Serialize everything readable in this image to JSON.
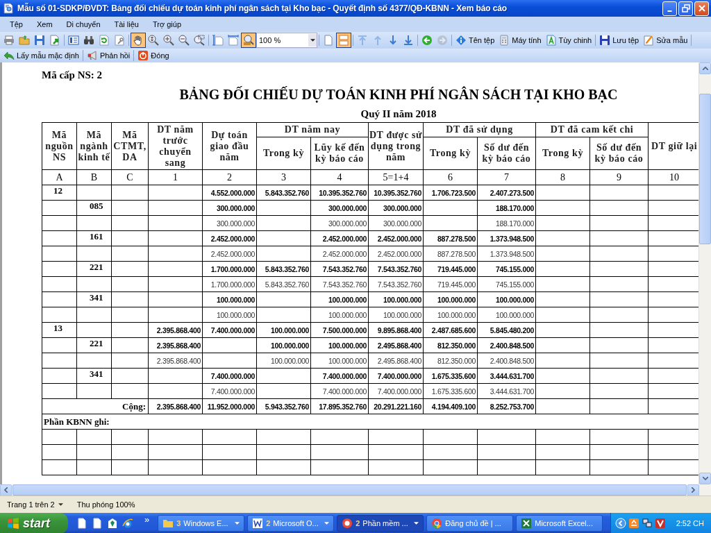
{
  "window": {
    "title": "Mẫu số 01-SDKP/ĐVDT: Bảng đối chiếu dự toán kinh phí ngân sách tại Kho bạc - Quyết định số 4377/QĐ-KBNN - Xem báo cáo"
  },
  "menu": [
    "Tệp",
    "Xem",
    "Di chuyển",
    "Tài liệu",
    "Trợ giúp"
  ],
  "toolbar": [
    {
      "kind": "button",
      "selected": false,
      "disabled": false
    },
    {
      "kind": "button",
      "selected": false,
      "disabled": false
    },
    {
      "kind": "button",
      "selected": false,
      "disabled": false
    },
    {
      "kind": "button",
      "selected": false,
      "disabled": false
    },
    {
      "kind": "separator"
    },
    {
      "kind": "button",
      "selected": false,
      "disabled": false
    },
    {
      "kind": "button",
      "selected": false,
      "disabled": false
    },
    {
      "kind": "button",
      "selected": false,
      "disabled": false
    },
    {
      "kind": "button",
      "selected": false,
      "disabled": false
    },
    {
      "kind": "separator"
    },
    {
      "kind": "button",
      "selected": true,
      "disabled": false
    },
    {
      "kind": "button",
      "selected": false,
      "disabled": false
    },
    {
      "kind": "button",
      "selected": false,
      "disabled": false
    },
    {
      "kind": "button",
      "selected": false,
      "disabled": false
    },
    {
      "kind": "button",
      "selected": false,
      "disabled": false
    },
    {
      "kind": "separator"
    },
    {
      "kind": "button",
      "selected": false,
      "disabled": false
    },
    {
      "kind": "button",
      "selected": false,
      "disabled": false
    },
    {
      "kind": "button",
      "selected": true,
      "disabled": false
    },
    {
      "kind": "combo",
      "value": "100 %"
    },
    {
      "kind": "separator"
    },
    {
      "kind": "button",
      "selected": false,
      "disabled": false
    },
    {
      "kind": "button",
      "selected": true,
      "disabled": false
    },
    {
      "kind": "separator"
    },
    {
      "kind": "button",
      "selected": false,
      "disabled": true
    },
    {
      "kind": "button",
      "selected": false,
      "disabled": true
    },
    {
      "kind": "button",
      "selected": false,
      "disabled": false
    },
    {
      "kind": "button",
      "selected": false,
      "disabled": false
    },
    {
      "kind": "separator"
    },
    {
      "kind": "button",
      "selected": false,
      "disabled": false
    },
    {
      "kind": "button",
      "selected": false,
      "disabled": true
    },
    {
      "kind": "separator"
    },
    {
      "kind": "button",
      "label": "Tên tệp",
      "selected": false,
      "disabled": false
    },
    {
      "kind": "button",
      "label": "Máy tính",
      "selected": false,
      "disabled": false
    },
    {
      "kind": "button",
      "label": "Tùy chinh",
      "selected": false,
      "disabled": false
    },
    {
      "kind": "separator"
    },
    {
      "kind": "button",
      "label": "Lưu tệp",
      "selected": false,
      "disabled": false
    },
    {
      "kind": "button",
      "label": "Sửa mẫu",
      "selected": false,
      "disabled": false
    },
    {
      "kind": "separator"
    }
  ],
  "toolbar2": [
    {
      "kind": "button",
      "label": "Lấy mẫu mặc định",
      "selected": false,
      "disabled": false
    },
    {
      "kind": "separator"
    },
    {
      "kind": "button",
      "label": "Phản hồi",
      "selected": false,
      "disabled": false
    },
    {
      "kind": "separator"
    },
    {
      "kind": "button",
      "label": "Đóng",
      "selected": false,
      "disabled": false
    }
  ],
  "report": {
    "unit_level": "Mã cấp NS: 2",
    "title": "BẢNG ĐỐI CHIẾU DỰ TOÁN KINH PHÍ NGÂN SÁCH TẠI KHO BẠC",
    "period": "Quý II năm 2018",
    "header": [
      {
        "label": "Mã nguồn NS"
      },
      {
        "label": "Mã ngành kinh tế"
      },
      {
        "label": "Mã CTMT, DA"
      },
      {
        "label": "DT năm trước chuyển sang"
      },
      {
        "label": "Dự toán giao đầu năm"
      },
      {
        "label": "DT năm nay",
        "children": [
          {
            "label": "Trong kỳ"
          },
          {
            "label": "Lũy kế đến kỳ báo cáo"
          }
        ]
      },
      {
        "label": "DT được sử dụng trong năm"
      },
      {
        "label": "DT đã sử dụng",
        "children": [
          {
            "label": "Trong kỳ"
          },
          {
            "label": "Số dư đến kỳ báo cáo"
          }
        ]
      },
      {
        "label": "DT đã cam kết chi",
        "children": [
          {
            "label": "Trong kỳ"
          },
          {
            "label": "Số dư đến kỳ báo cáo"
          }
        ]
      },
      {
        "label": "DT giữ lại"
      }
    ],
    "column_numbers": [
      "A",
      "B",
      "C",
      "1",
      "2",
      "3",
      "4",
      "5=1+4",
      "6",
      "7",
      "8",
      "9",
      "10"
    ],
    "rows": [
      {
        "kind": "bold",
        "cells": [
          "12",
          null,
          null,
          null,
          "4.552.000.000",
          "5.843.352.760",
          "10.395.352.760",
          "10.395.352.760",
          "1.706.723.500",
          "2.407.273.500",
          null,
          null,
          null
        ]
      },
      {
        "kind": "bold",
        "cells": [
          null,
          "085",
          null,
          null,
          "300.000.000",
          null,
          "300.000.000",
          "300.000.000",
          null,
          "188.170.000",
          null,
          null,
          null
        ]
      },
      {
        "kind": "plain",
        "cells": [
          null,
          null,
          null,
          null,
          "300.000.000",
          null,
          "300.000.000",
          "300.000.000",
          null,
          "188.170.000",
          null,
          null,
          null
        ]
      },
      {
        "kind": "bold",
        "cells": [
          null,
          "161",
          null,
          null,
          "2.452.000.000",
          null,
          "2.452.000.000",
          "2.452.000.000",
          "887.278.500",
          "1.373.948.500",
          null,
          null,
          null
        ]
      },
      {
        "kind": "plain",
        "cells": [
          null,
          null,
          null,
          null,
          "2.452.000.000",
          null,
          "2.452.000.000",
          "2.452.000.000",
          "887.278.500",
          "1.373.948.500",
          null,
          null,
          null
        ]
      },
      {
        "kind": "bold",
        "cells": [
          null,
          "221",
          null,
          null,
          "1.700.000.000",
          "5.843.352.760",
          "7.543.352.760",
          "7.543.352.760",
          "719.445.000",
          "745.155.000",
          null,
          null,
          null
        ]
      },
      {
        "kind": "plain",
        "cells": [
          null,
          null,
          null,
          null,
          "1.700.000.000",
          "5.843.352.760",
          "7.543.352.760",
          "7.543.352.760",
          "719.445.000",
          "745.155.000",
          null,
          null,
          null
        ]
      },
      {
        "kind": "bold",
        "cells": [
          null,
          "341",
          null,
          null,
          "100.000.000",
          null,
          "100.000.000",
          "100.000.000",
          "100.000.000",
          "100.000.000",
          null,
          null,
          null
        ]
      },
      {
        "kind": "plain",
        "cells": [
          null,
          null,
          null,
          null,
          "100.000.000",
          null,
          "100.000.000",
          "100.000.000",
          "100.000.000",
          "100.000.000",
          null,
          null,
          null
        ]
      },
      {
        "kind": "bold",
        "cells": [
          "13",
          null,
          null,
          "2.395.868.400",
          "7.400.000.000",
          "100.000.000",
          "7.500.000.000",
          "9.895.868.400",
          "2.487.685.600",
          "5.845.480.200",
          null,
          null,
          null
        ]
      },
      {
        "kind": "bold",
        "cells": [
          null,
          "221",
          null,
          "2.395.868.400",
          null,
          "100.000.000",
          "100.000.000",
          "2.495.868.400",
          "812.350.000",
          "2.400.848.500",
          null,
          null,
          null
        ]
      },
      {
        "kind": "plain",
        "cells": [
          null,
          null,
          null,
          "2.395.868.400",
          null,
          "100.000.000",
          "100.000.000",
          "2.495.868.400",
          "812.350.000",
          "2.400.848.500",
          null,
          null,
          null
        ]
      },
      {
        "kind": "bold",
        "cells": [
          null,
          "341",
          null,
          null,
          "7.400.000.000",
          null,
          "7.400.000.000",
          "7.400.000.000",
          "1.675.335.600",
          "3.444.631.700",
          null,
          null,
          null
        ]
      },
      {
        "kind": "plain",
        "cells": [
          null,
          null,
          null,
          null,
          "7.400.000.000",
          null,
          "7.400.000.000",
          "7.400.000.000",
          "1.675.335.600",
          "3.444.631.700",
          null,
          null,
          null
        ]
      }
    ],
    "total": {
      "label": "Cộng:",
      "cells": [
        "2.395.868.400",
        "11.952.000.000",
        "5.943.352.760",
        "17.895.352.760",
        "20.291.221.160",
        "4.194.409.100",
        "8.252.753.700",
        null,
        null,
        null
      ]
    },
    "note_label": "Phần KBNN ghi:"
  },
  "status_bar": {
    "page": "Trang 1 trên 2",
    "zoom": "Thu phóng 100%"
  },
  "taskbar": {
    "start": "start",
    "more": "»",
    "tasks": [
      {
        "count": "3",
        "label": "Windows E...",
        "selected": false,
        "grouped": true
      },
      {
        "count": "2",
        "label": "Microsoft O...",
        "selected": false,
        "grouped": true
      },
      {
        "count": "2",
        "label": "Phần mềm ...",
        "selected": true,
        "grouped": true
      },
      {
        "label": "Đăng chủ đề | ...",
        "selected": false,
        "grouped": false
      },
      {
        "label": "Microsoft Excel...",
        "selected": false,
        "grouped": false
      }
    ],
    "clock": "2:52 CH"
  }
}
